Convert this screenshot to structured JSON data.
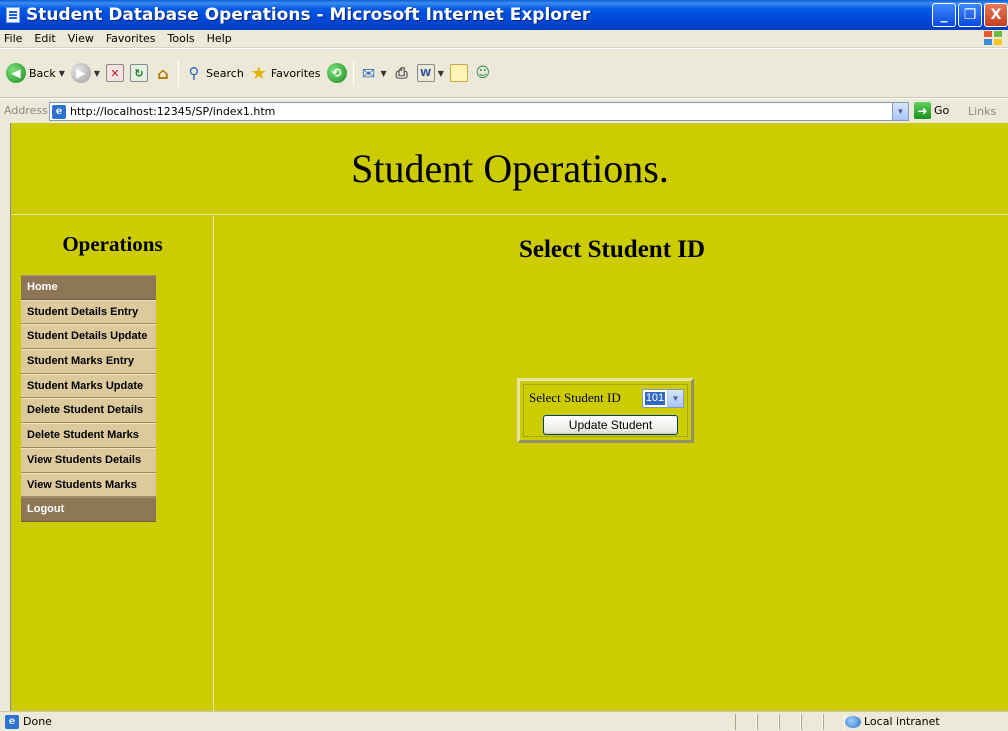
{
  "window": {
    "title": "Student Database Operations - Microsoft Internet Explorer",
    "minimize": "_",
    "maximize": "❐",
    "close": "X"
  },
  "menu": [
    "File",
    "Edit",
    "View",
    "Favorites",
    "Tools",
    "Help"
  ],
  "toolbar": {
    "back_label": "Back",
    "search_label": "Search",
    "favorites_label": "Favorites",
    "icons": [
      "back-icon",
      "forward-icon",
      "stop-icon",
      "refresh-icon",
      "home-icon",
      "search-icon",
      "favorites-icon",
      "history-icon",
      "mail-icon",
      "print-icon",
      "edit-icon",
      "messenger-icon"
    ]
  },
  "address": {
    "label": "Address",
    "url": "http://localhost:12345/SP/index1.htm",
    "go_label": "Go",
    "links_label": "Links"
  },
  "page": {
    "title": "Student Operations.",
    "sidebar_title": "Operations",
    "nav": [
      "Home",
      "Student Details Entry",
      "Student Details Update",
      "Student Marks Entry",
      "Student Marks Update",
      "Delete Student Details",
      "Delete Student Marks",
      "View Students Details",
      "View Students Marks",
      "Logout"
    ],
    "heading": "Select Student ID",
    "form": {
      "label": "Select Student ID",
      "selected_id": "101",
      "button_label": "Update Student"
    }
  },
  "status": {
    "text": "Done",
    "zone": "Local intranet"
  },
  "colors": {
    "page_bg": "#cccc00",
    "nav_light": "#dcc99c",
    "nav_dark": "#8d7756"
  }
}
